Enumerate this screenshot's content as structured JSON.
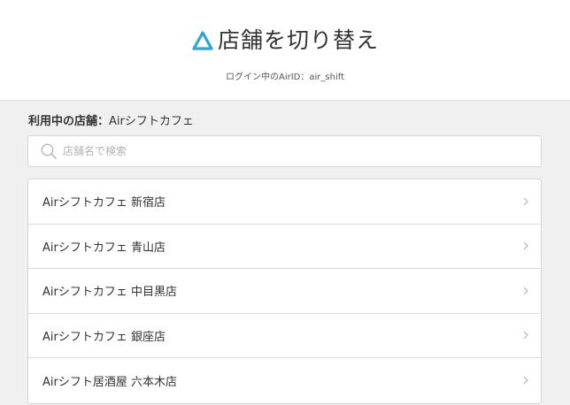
{
  "header": {
    "title": "店舗を切り替え",
    "airid_prefix": "ログイン中のAirID：",
    "airid_value": "air_shift",
    "logo_color": "#2aa5d9"
  },
  "current_store": {
    "label": "利用中の店舗：",
    "name": "Airシフトカフェ"
  },
  "search": {
    "placeholder": "店舗名で検索",
    "value": "",
    "icon": "search-icon"
  },
  "stores": [
    {
      "name": "Airシフトカフェ 新宿店"
    },
    {
      "name": "Airシフトカフェ 青山店"
    },
    {
      "name": "Airシフトカフェ 中目黒店"
    },
    {
      "name": "Airシフトカフェ 銀座店"
    },
    {
      "name": "Airシフト居酒屋 六本木店"
    }
  ],
  "colors": {
    "background": "#f0f0f0",
    "panel": "#ffffff",
    "text": "#333333",
    "muted": "#b4b4b4",
    "accent": "#2aa5d9"
  }
}
